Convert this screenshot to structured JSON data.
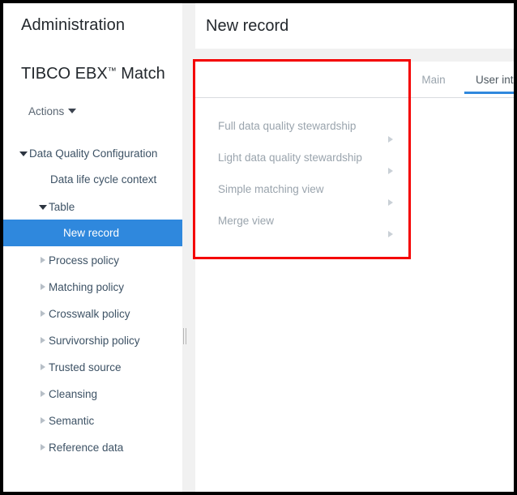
{
  "sidebar": {
    "header": "Administration",
    "product_title": "TIBCO EBX",
    "product_title_tm": "™",
    "product_title_suffix": " Match",
    "actions_label": "Actions",
    "actions_icon": "caret-down-icon",
    "tree": [
      {
        "label": "Data Quality Configuration",
        "icon": "triangle-down-icon",
        "indent": 0,
        "selected": false,
        "expanded": true
      },
      {
        "label": "Data life cycle context",
        "icon": "none",
        "indent": 1,
        "selected": false,
        "expanded": false
      },
      {
        "label": "Table",
        "icon": "triangle-down-icon",
        "indent": 1,
        "selected": false,
        "expanded": true
      },
      {
        "label": "New record",
        "icon": "none",
        "indent": 2,
        "selected": true,
        "expanded": false
      },
      {
        "label": "Process policy",
        "icon": "triangle-right-icon",
        "indent": 1,
        "selected": false,
        "expanded": false
      },
      {
        "label": "Matching policy",
        "icon": "triangle-right-icon",
        "indent": 1,
        "selected": false,
        "expanded": false
      },
      {
        "label": "Crosswalk policy",
        "icon": "triangle-right-icon",
        "indent": 1,
        "selected": false,
        "expanded": false
      },
      {
        "label": "Survivorship policy",
        "icon": "triangle-right-icon",
        "indent": 1,
        "selected": false,
        "expanded": false
      },
      {
        "label": "Trusted source",
        "icon": "triangle-right-icon",
        "indent": 1,
        "selected": false,
        "expanded": false
      },
      {
        "label": "Cleansing",
        "icon": "triangle-right-icon",
        "indent": 1,
        "selected": false,
        "expanded": false
      },
      {
        "label": "Semantic",
        "icon": "triangle-right-icon",
        "indent": 1,
        "selected": false,
        "expanded": false
      },
      {
        "label": "Reference data",
        "icon": "triangle-right-icon",
        "indent": 1,
        "selected": false,
        "expanded": false
      }
    ],
    "resize_handle_icon": "resize-grip-icon"
  },
  "main": {
    "title": "New record",
    "tabs": [
      {
        "label": "Main",
        "active": false
      },
      {
        "label": "User interface",
        "active": true
      }
    ],
    "menu_items": [
      {
        "label": "Full data quality stewardship",
        "icon": "triangle-right-icon"
      },
      {
        "label": "Light data quality stewardship",
        "icon": "triangle-right-icon"
      },
      {
        "label": "Simple matching view",
        "icon": "triangle-right-icon"
      },
      {
        "label": "Merge view",
        "icon": "triangle-right-icon"
      }
    ]
  },
  "colors": {
    "accent_blue": "#2f88dd",
    "selected_row_bg": "#2f88dd",
    "annotation_red": "#f40000",
    "text_dark": "#23282d",
    "text_muted": "#9aa4ad",
    "tree_text": "#3d5265",
    "gutter_bg": "#f1f1f1"
  }
}
